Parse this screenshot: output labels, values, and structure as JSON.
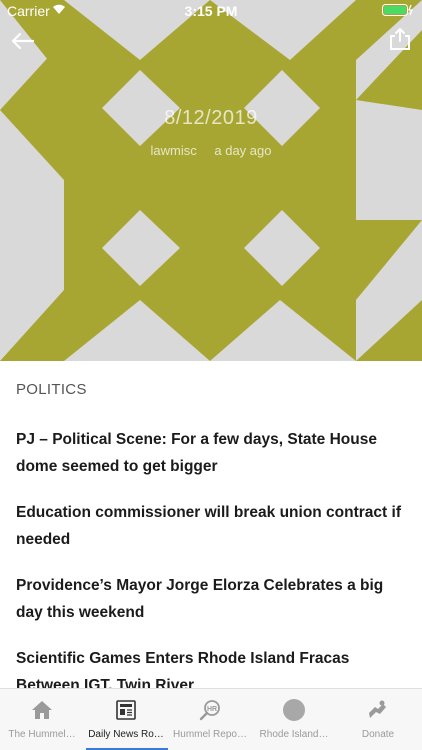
{
  "status_bar": {
    "carrier": "Carrier",
    "time": "3:15 PM",
    "battery_color": "#4cd964"
  },
  "hero": {
    "date": "8/12/2019",
    "author": "lawmisc",
    "time_ago": "a day ago",
    "pattern_color": "#a8a633",
    "background_color": "#d9d9d9"
  },
  "section": {
    "title": "POLITICS"
  },
  "articles": [
    {
      "title": "PJ – Political Scene: For a few days, State House dome seemed to get bigger"
    },
    {
      "title": "Education commissioner will break union contract if needed"
    },
    {
      "title": "Providence’s Mayor Jorge Elorza Celebrates a big day this weekend"
    },
    {
      "title": "Scientific Games Enters Rhode Island Fracas Between IGT, Twin River"
    }
  ],
  "tabs": [
    {
      "label": "The Hummel…",
      "icon": "home-icon"
    },
    {
      "label": "Daily News Ro…",
      "icon": "newspaper-icon",
      "active": true
    },
    {
      "label": "Hummel Repo…",
      "icon": "hr-search-icon"
    },
    {
      "label": "Rhode Island…",
      "icon": "circle-icon"
    },
    {
      "label": "Donate",
      "icon": "donate-icon"
    }
  ]
}
